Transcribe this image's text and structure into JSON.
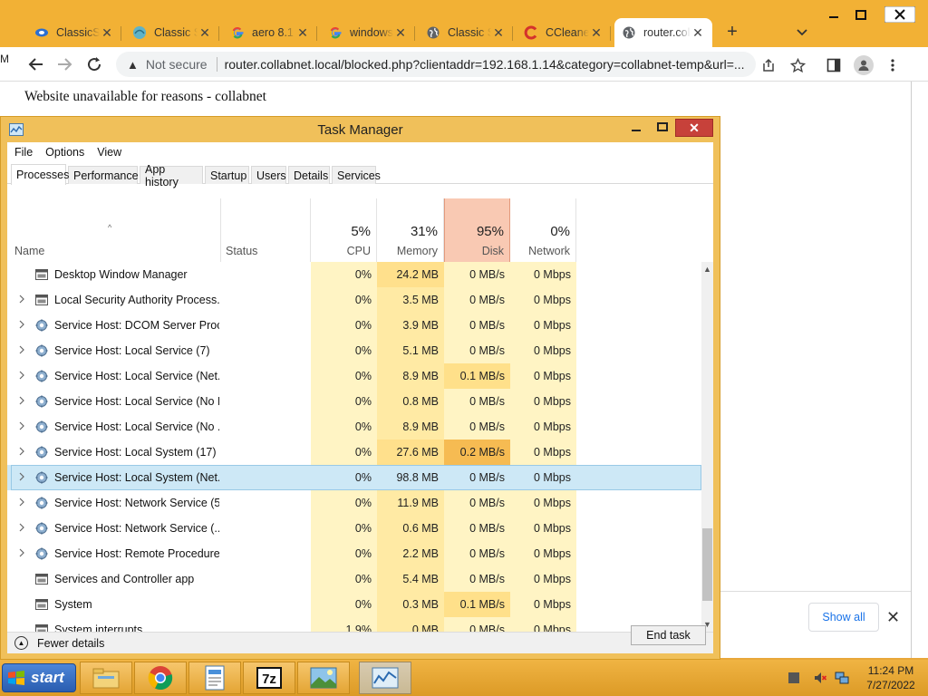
{
  "browser": {
    "tabs": [
      {
        "label": "ClassicShell",
        "icon": "classic-shell-icon"
      },
      {
        "label": "Classic Shell",
        "icon": "classic-shell-shell-icon"
      },
      {
        "label": "aero 8.1",
        "icon": "google-icon"
      },
      {
        "label": "windows",
        "icon": "google-icon"
      },
      {
        "label": "Classic Shell",
        "icon": "globe-icon"
      },
      {
        "label": "CCleaner",
        "icon": "ccleaner-icon"
      },
      {
        "label": "router.collabnet",
        "icon": "globe-icon"
      }
    ],
    "new_tab": "+",
    "omnibox": {
      "security": "Not secure",
      "url": "router.collabnet.local/blocked.php?clientaddr=192.168.1.14&category=collabnet-temp&url=..."
    },
    "page_text": "Website unavailable for reasons - collabnet",
    "download_bar": {
      "show_all": "Show all"
    }
  },
  "task_manager": {
    "title": "Task Manager",
    "menu": [
      "File",
      "Options",
      "View"
    ],
    "tabs": [
      "Processes",
      "Performance",
      "App history",
      "Startup",
      "Users",
      "Details",
      "Services"
    ],
    "active_tab": "Processes",
    "columns": {
      "name": "Name",
      "status": "Status",
      "cpu": {
        "label": "CPU",
        "pct": "5%"
      },
      "memory": {
        "label": "Memory",
        "pct": "31%"
      },
      "disk": {
        "label": "Disk",
        "pct": "95%"
      },
      "network": {
        "label": "Network",
        "pct": "0%"
      }
    },
    "processes": [
      {
        "name": "Desktop Window Manager",
        "expandable": false,
        "icon": "window-icon",
        "cpu": "0%",
        "memory": "24.2 MB",
        "disk": "0 MB/s",
        "network": "0 Mbps"
      },
      {
        "name": "Local Security Authority Process...",
        "expandable": true,
        "icon": "window-icon",
        "cpu": "0%",
        "memory": "3.5 MB",
        "disk": "0 MB/s",
        "network": "0 Mbps"
      },
      {
        "name": "Service Host: DCOM Server Proc...",
        "expandable": true,
        "icon": "gear-icon",
        "cpu": "0%",
        "memory": "3.9 MB",
        "disk": "0 MB/s",
        "network": "0 Mbps"
      },
      {
        "name": "Service Host: Local Service (7)",
        "expandable": true,
        "icon": "gear-icon",
        "cpu": "0%",
        "memory": "5.1 MB",
        "disk": "0 MB/s",
        "network": "0 Mbps"
      },
      {
        "name": "Service Host: Local Service (Net...",
        "expandable": true,
        "icon": "gear-icon",
        "cpu": "0%",
        "memory": "8.9 MB",
        "disk": "0.1 MB/s",
        "network": "0 Mbps"
      },
      {
        "name": "Service Host: Local Service (No I...",
        "expandable": true,
        "icon": "gear-icon",
        "cpu": "0%",
        "memory": "0.8 MB",
        "disk": "0 MB/s",
        "network": "0 Mbps"
      },
      {
        "name": "Service Host: Local Service (No ...",
        "expandable": true,
        "icon": "gear-icon",
        "cpu": "0%",
        "memory": "8.9 MB",
        "disk": "0 MB/s",
        "network": "0 Mbps"
      },
      {
        "name": "Service Host: Local System (17)",
        "expandable": true,
        "icon": "gear-icon",
        "cpu": "0%",
        "memory": "27.6 MB",
        "disk": "0.2 MB/s",
        "network": "0 Mbps"
      },
      {
        "name": "Service Host: Local System (Net...",
        "expandable": true,
        "icon": "gear-icon",
        "cpu": "0%",
        "memory": "98.8 MB",
        "disk": "0 MB/s",
        "network": "0 Mbps",
        "selected": true
      },
      {
        "name": "Service Host: Network Service (5)",
        "expandable": true,
        "icon": "gear-icon",
        "cpu": "0%",
        "memory": "11.9 MB",
        "disk": "0 MB/s",
        "network": "0 Mbps"
      },
      {
        "name": "Service Host: Network Service (...",
        "expandable": true,
        "icon": "gear-icon",
        "cpu": "0%",
        "memory": "0.6 MB",
        "disk": "0 MB/s",
        "network": "0 Mbps"
      },
      {
        "name": "Service Host: Remote Procedure...",
        "expandable": true,
        "icon": "gear-icon",
        "cpu": "0%",
        "memory": "2.2 MB",
        "disk": "0 MB/s",
        "network": "0 Mbps"
      },
      {
        "name": "Services and Controller app",
        "expandable": false,
        "icon": "window-icon",
        "cpu": "0%",
        "memory": "5.4 MB",
        "disk": "0 MB/s",
        "network": "0 Mbps"
      },
      {
        "name": "System",
        "expandable": false,
        "icon": "window-icon",
        "cpu": "0%",
        "memory": "0.3 MB",
        "disk": "0.1 MB/s",
        "network": "0 Mbps"
      },
      {
        "name": "System interrupts",
        "expandable": false,
        "icon": "window-icon",
        "cpu": "1.9%",
        "memory": "0 MB",
        "disk": "0 MB/s",
        "network": "0 Mbps"
      }
    ],
    "fewer_details": "Fewer details",
    "end_task": "End task"
  },
  "taskbar": {
    "start_label": "start",
    "apps": [
      "file-explorer-icon",
      "chrome-icon",
      "wordpad-icon",
      "7zip-icon",
      "photo-viewer-icon",
      "task-manager-icon"
    ],
    "clock": {
      "time": "11:24 PM",
      "date": "7/27/2022"
    }
  },
  "colors": {
    "accent": "#f2b135",
    "disk_header": "#f7c5b0",
    "close_red": "#c7413a",
    "selection": "#cde8f6"
  }
}
